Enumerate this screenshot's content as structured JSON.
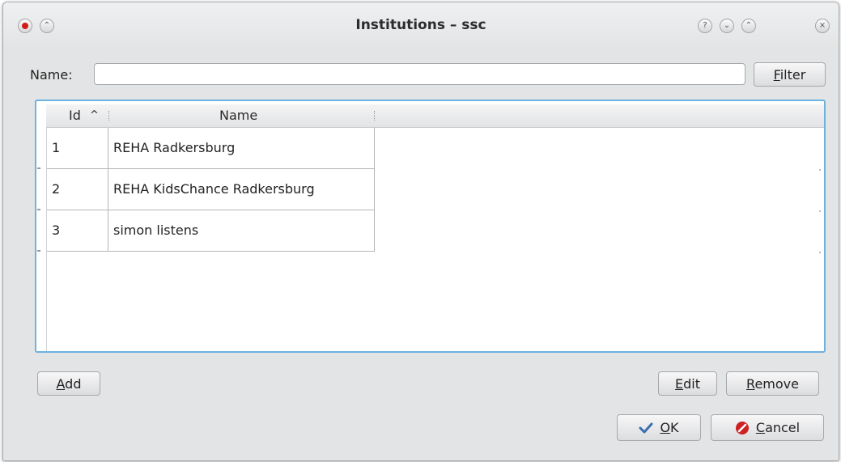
{
  "window": {
    "title": "Institutions – ssc",
    "titlebar_buttons_left": [
      "close-icon",
      "keep-above-icon"
    ],
    "titlebar_buttons_right": [
      "help-icon",
      "minimize-icon",
      "maximize-icon",
      "close-x-icon"
    ],
    "glyph_help": "?",
    "glyph_min": "⌄",
    "glyph_max": "⌃",
    "glyph_close": "×",
    "glyph_above": "⌃"
  },
  "filter": {
    "label": "Name:",
    "value": "",
    "placeholder": "",
    "button_label_mnemonic": "F",
    "button_label_rest": "ilter"
  },
  "table": {
    "columns": [
      "Id",
      "Name"
    ],
    "sort_indicator": "^",
    "rows": [
      {
        "id": "1",
        "name": "REHA Radkersburg"
      },
      {
        "id": "2",
        "name": "REHA KidsChance Radkersburg"
      },
      {
        "id": "3",
        "name": "simon listens"
      }
    ]
  },
  "buttons": {
    "add_mnemonic": "A",
    "add_rest": "dd",
    "edit_mnemonic": "E",
    "edit_rest": "dit",
    "remove_mnemonic": "R",
    "remove_rest": "emove",
    "ok_mnemonic": "O",
    "ok_rest": "K",
    "cancel_mnemonic": "C",
    "cancel_rest": "ancel"
  },
  "colors": {
    "accent_focus": "#6eb2e0",
    "close_red": "#d21b1b",
    "ok_check": "#3a6fb0",
    "cancel_red": "#cc2222"
  }
}
